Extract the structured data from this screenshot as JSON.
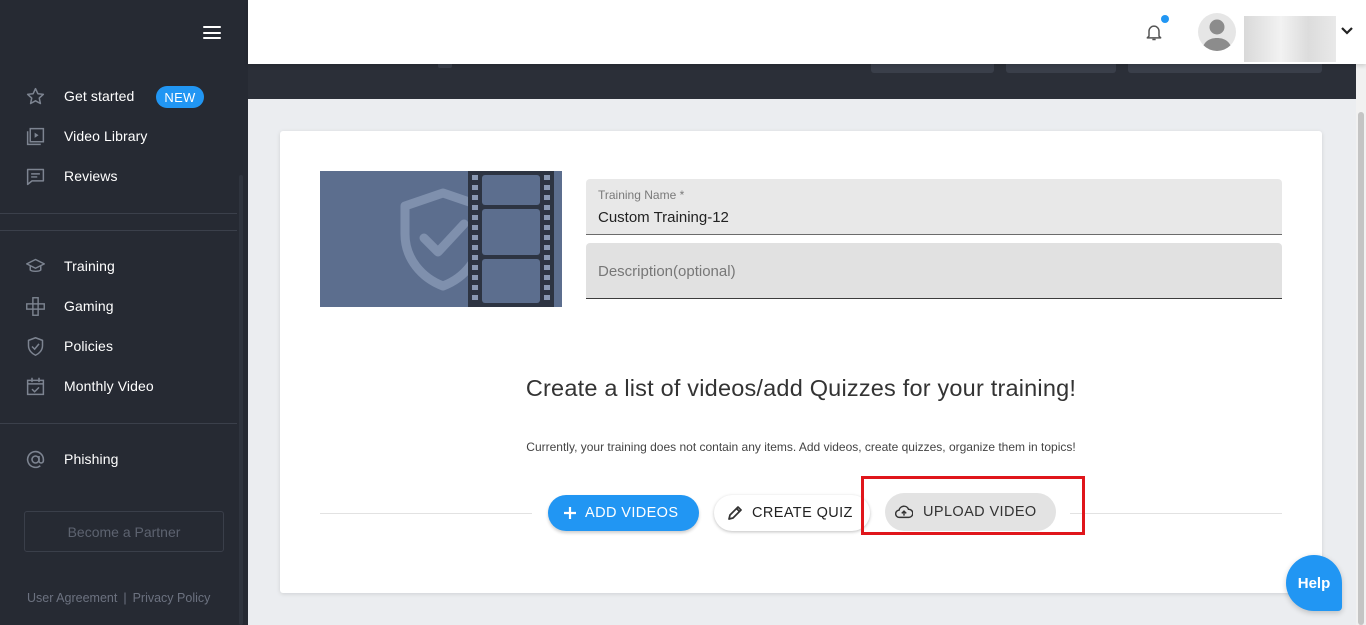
{
  "sidebar": {
    "menu_icon": "hamburger-menu-icon",
    "group1": [
      {
        "label": "Get started",
        "icon": "star-icon"
      },
      {
        "label": "Video Library",
        "icon": "video-library-icon"
      },
      {
        "label": "Reviews",
        "icon": "comment-icon"
      }
    ],
    "new_badge": "NEW",
    "group2": [
      {
        "label": "Training",
        "icon": "graduation-cap-icon"
      },
      {
        "label": "Gaming",
        "icon": "gamepad-icon"
      },
      {
        "label": "Policies",
        "icon": "shield-check-icon"
      },
      {
        "label": "Monthly Video",
        "icon": "calendar-check-icon"
      }
    ],
    "group3": [
      {
        "label": "Phishing",
        "icon": "at-sign-icon"
      }
    ],
    "partner_button": "Become a Partner",
    "footer": {
      "user_agreement": "User Agreement",
      "separator": "|",
      "privacy_policy": "Privacy Policy"
    }
  },
  "header": {
    "notification_icon": "bell-icon",
    "avatar_icon": "user-avatar-icon",
    "menu_chevron": "chevron-down-icon"
  },
  "training": {
    "name_label": "Training Name *",
    "name_value": "Custom Training-12",
    "description_placeholder": "Description(optional)",
    "headline": "Create a list of videos/add Quizzes for your training!",
    "subtext": "Currently, your training does not contain any items. Add videos, create quizzes, organize them in topics!",
    "add_videos_label": "ADD VIDEOS",
    "create_quiz_label": "CREATE QUIZ",
    "upload_video_label": "UPLOAD VIDEO"
  },
  "help_button": "Help",
  "colors": {
    "sidebar_bg": "#262a33",
    "accent": "#2196f3",
    "highlight": "#e0161b",
    "thumbnail_bg": "#5c6e8e"
  }
}
